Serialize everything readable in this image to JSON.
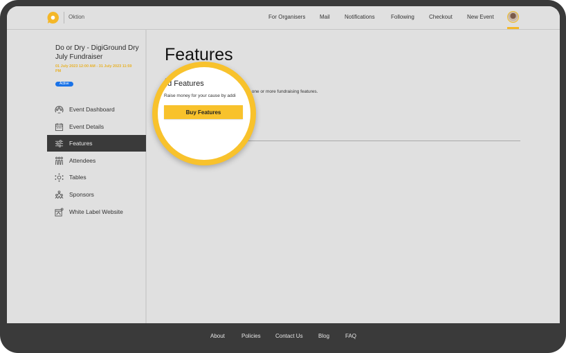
{
  "header": {
    "brand": "Oktion",
    "nav": [
      "For Organisers",
      "Mail",
      "Notifications",
      "Following",
      "Checkout",
      "New Event"
    ],
    "avatar_icon": "user-avatar"
  },
  "event": {
    "title": "Do or Dry - DigiGround Dry July Fundraiser",
    "dates": "01 July 2023 12:00 AM - 31 July 2023 11:59 PM",
    "status": "Active"
  },
  "sidebar": {
    "items": [
      {
        "label": "Event Dashboard",
        "icon": "dashboard-icon",
        "active": false
      },
      {
        "label": "Event Details",
        "icon": "calendar-icon",
        "active": false
      },
      {
        "label": "Features",
        "icon": "sliders-icon",
        "active": true
      },
      {
        "label": "Attendees",
        "icon": "attendees-icon",
        "active": false
      },
      {
        "label": "Tables",
        "icon": "tables-icon",
        "active": false
      },
      {
        "label": "Sponsors",
        "icon": "sponsors-icon",
        "active": false
      },
      {
        "label": "White Label Website",
        "icon": "website-icon",
        "active": false
      }
    ]
  },
  "main": {
    "title": "Features",
    "section_title": "Add Features",
    "section_title_visible": "dd Features",
    "description": "Raise money for your cause by adding one or more fundraising features.",
    "description_left": "Raise money for your cause by addi",
    "description_right": "one or more fundraising features.",
    "buy_button": "Buy Features"
  },
  "footer": {
    "links": [
      "About",
      "Policies",
      "Contact Us",
      "Blog",
      "FAQ"
    ]
  },
  "colors": {
    "accent": "#f8c22c",
    "dates": "#e8b22a",
    "badge": "#1a73e8",
    "dark": "#3a3a3a"
  }
}
